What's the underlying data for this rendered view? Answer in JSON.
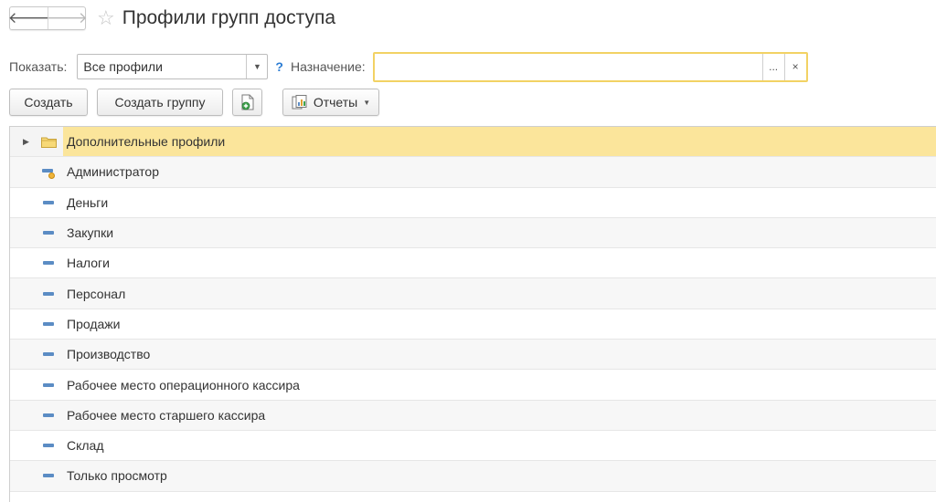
{
  "window": {
    "title": "Профили групп доступа"
  },
  "nav": {
    "back_glyph": "🡐",
    "forward_glyph": "🡒",
    "star_glyph": "☆"
  },
  "filter": {
    "show_label": "Показать:",
    "show_value": "Все профили",
    "help_glyph": "?",
    "purpose_label": "Назначение:",
    "purpose_value": "",
    "select_button": "...",
    "clear_button": "×"
  },
  "toolbar": {
    "create_label": "Создать",
    "create_group_label": "Создать группу",
    "reports_label": "Отчеты"
  },
  "list": {
    "rows": [
      {
        "label": "Дополнительные профили",
        "icon": "folder-icon"
      },
      {
        "label": "Администратор",
        "icon": "admin-profile-icon"
      },
      {
        "label": "Деньги",
        "icon": "profile-icon"
      },
      {
        "label": "Закупки",
        "icon": "profile-icon"
      },
      {
        "label": "Налоги",
        "icon": "profile-icon"
      },
      {
        "label": "Персонал",
        "icon": "profile-icon"
      },
      {
        "label": "Продажи",
        "icon": "profile-icon"
      },
      {
        "label": "Производство",
        "icon": "profile-icon"
      },
      {
        "label": "Рабочее место операционного кассира",
        "icon": "profile-icon"
      },
      {
        "label": "Рабочее место старшего кассира",
        "icon": "profile-icon"
      },
      {
        "label": "Склад",
        "icon": "profile-icon"
      },
      {
        "label": "Только просмотр",
        "icon": "profile-icon"
      }
    ]
  },
  "colors": {
    "accent_field_border": "#f2d264",
    "selected_row": "#fbe59b",
    "profile_icon": "#5b8cc4",
    "help": "#2b7cd3"
  }
}
